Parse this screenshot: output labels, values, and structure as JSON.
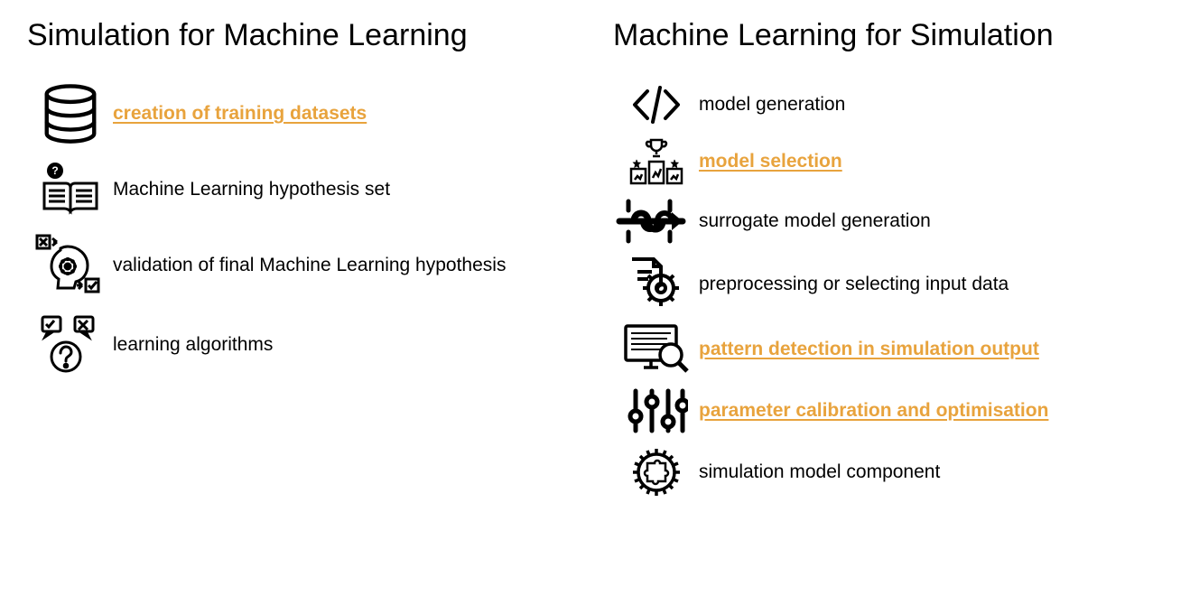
{
  "left": {
    "title": "Simulation for Machine Learning",
    "items": [
      {
        "label": "creation of training datasets",
        "highlight": true
      },
      {
        "label": "Machine Learning hypothesis set",
        "highlight": false
      },
      {
        "label": "validation of final Machine Learning hypothesis",
        "highlight": false
      },
      {
        "label": "learning algorithms",
        "highlight": false
      }
    ]
  },
  "right": {
    "title": "Machine Learning for Simulation",
    "items": [
      {
        "label": "model generation",
        "highlight": false
      },
      {
        "label": "model selection",
        "highlight": true
      },
      {
        "label": "surrogate model generation",
        "highlight": false
      },
      {
        "label": "preprocessing or selecting input data",
        "highlight": false
      },
      {
        "label": "pattern detection in simulation output",
        "highlight": true
      },
      {
        "label": "parameter calibration and optimisation",
        "highlight": true
      },
      {
        "label": "simulation model component",
        "highlight": false
      }
    ]
  },
  "color": {
    "highlight": "#e8a33d"
  }
}
